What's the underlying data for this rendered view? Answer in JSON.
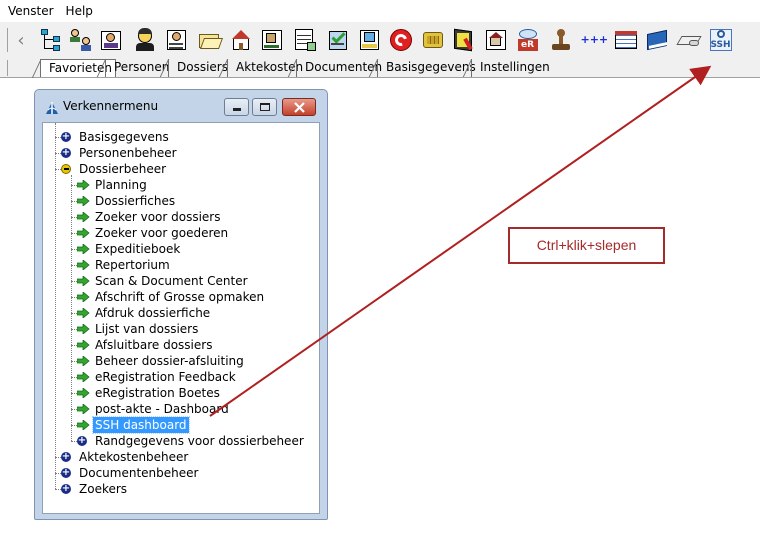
{
  "menubar": {
    "items": [
      "Venster",
      "Help"
    ]
  },
  "toolbar": {
    "icons": [
      "network-tree-icon",
      "persons-tree-icon",
      "dossier-card-icon",
      "person-icon",
      "search-person-icon",
      "open-folder-icon",
      "house-icon",
      "building-doc-icon",
      "spreadsheet-doc-icon",
      "checklist-icon",
      "scan-document-icon",
      "red-circle-logo-icon",
      "chip-card-icon",
      "notebook-pen-icon",
      "house-photo-icon",
      "eR-icon",
      "stamp-icon",
      "plus-plus-plus-icon",
      "table-grid-icon",
      "blue-book-icon",
      "hand-document-icon",
      "ssh-icon"
    ],
    "text_plus": "+++",
    "text_ssh": "SSH",
    "text_er": "eR"
  },
  "tabs": [
    "Favorieten",
    "Personen",
    "Dossiers",
    "Aktekosten",
    "Documenten",
    "Basisgegevens",
    "Instellingen"
  ],
  "window": {
    "title": "Verkennermenu",
    "tree": [
      {
        "label": "Basisgegevens",
        "level": 0,
        "state": "collapsed"
      },
      {
        "label": "Personenbeheer",
        "level": 0,
        "state": "collapsed"
      },
      {
        "label": "Dossierbeheer",
        "level": 0,
        "state": "expanded"
      },
      {
        "label": "Planning",
        "level": 1,
        "state": "leaf"
      },
      {
        "label": "Dossierfiches",
        "level": 1,
        "state": "leaf"
      },
      {
        "label": "Zoeker voor dossiers",
        "level": 1,
        "state": "leaf"
      },
      {
        "label": "Zoeker voor goederen",
        "level": 1,
        "state": "leaf"
      },
      {
        "label": "Expeditieboek",
        "level": 1,
        "state": "leaf"
      },
      {
        "label": "Repertorium",
        "level": 1,
        "state": "leaf"
      },
      {
        "label": "Scan & Document Center",
        "level": 1,
        "state": "leaf"
      },
      {
        "label": "Afschrift of Grosse opmaken",
        "level": 1,
        "state": "leaf"
      },
      {
        "label": "Afdruk dossierfiche",
        "level": 1,
        "state": "leaf"
      },
      {
        "label": "Lijst van dossiers",
        "level": 1,
        "state": "leaf"
      },
      {
        "label": "Afsluitbare dossiers",
        "level": 1,
        "state": "leaf"
      },
      {
        "label": "Beheer dossier-afsluiting",
        "level": 1,
        "state": "leaf"
      },
      {
        "label": "eRegistration Feedback",
        "level": 1,
        "state": "leaf"
      },
      {
        "label": "eRegistration Boetes",
        "level": 1,
        "state": "leaf"
      },
      {
        "label": "post-akte - Dashboard",
        "level": 1,
        "state": "leaf"
      },
      {
        "label": "SSH dashboard",
        "level": 1,
        "state": "leaf",
        "selected": true
      },
      {
        "label": "Randgegevens voor dossierbeheer",
        "level": 1,
        "state": "collapsed"
      },
      {
        "label": "Aktekostenbeheer",
        "level": 0,
        "state": "collapsed"
      },
      {
        "label": "Documentenbeheer",
        "level": 0,
        "state": "collapsed"
      },
      {
        "label": "Zoekers",
        "level": 0,
        "state": "collapsed"
      }
    ]
  },
  "annotation": {
    "text": "Ctrl+klik+slepen",
    "color": "#a52a2a"
  },
  "colors": {
    "selection": "#3399ff",
    "toolbar_bg": "#f0f0f0",
    "window_frame": "#c3d4e8"
  }
}
